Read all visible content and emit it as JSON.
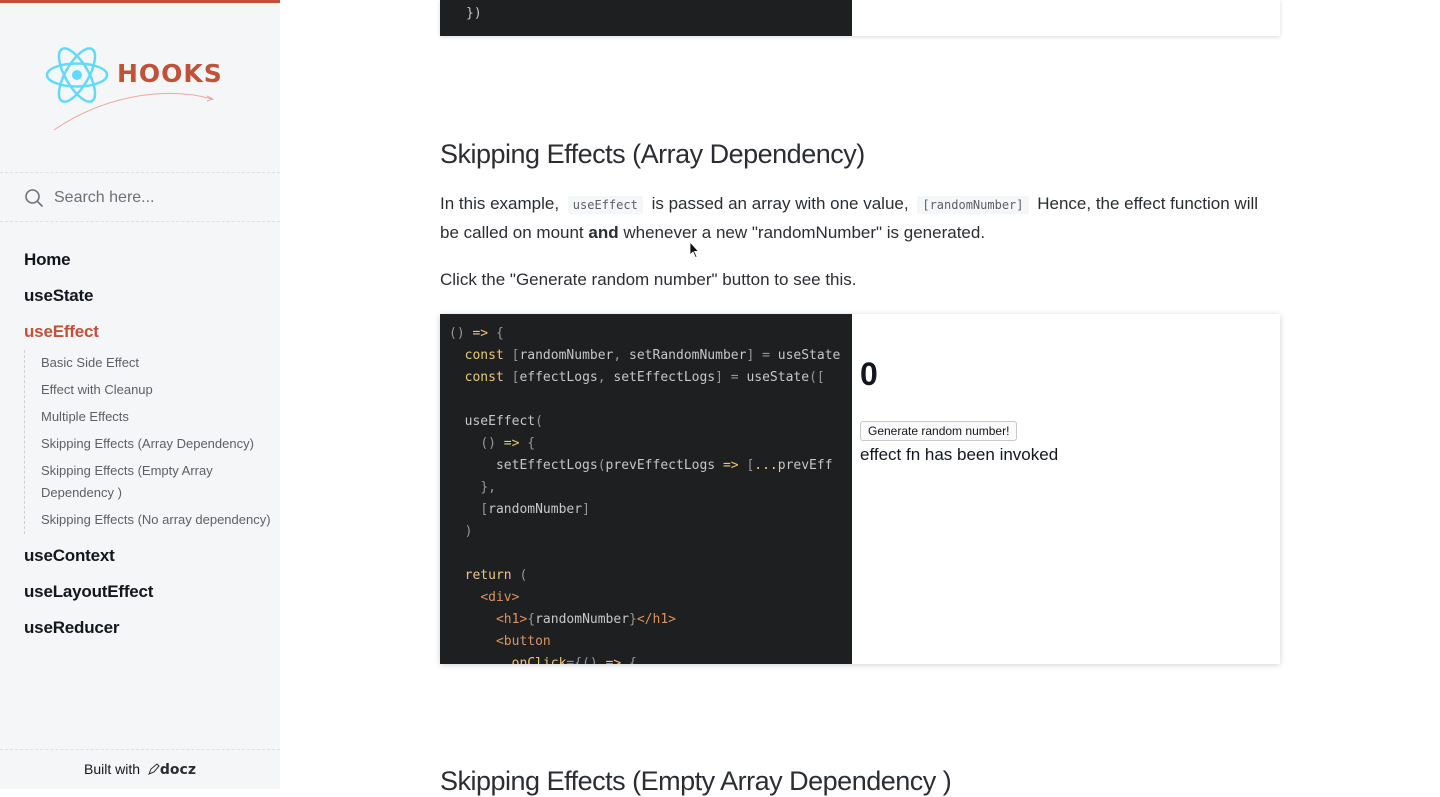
{
  "sidebar": {
    "logo_text": "HOOKS",
    "search_placeholder": "Search here...",
    "nav": {
      "home": "Home",
      "usestate": "useState",
      "useeffect": "useEffect",
      "sub_items": [
        "Basic Side Effect",
        "Effect with Cleanup",
        "Multiple Effects",
        "Skipping Effects (Array Dependency)",
        "Skipping Effects (Empty Array Dependency )",
        "Skipping Effects (No array dependency)"
      ],
      "usecontext": "useContext",
      "uselayouteffect": "useLayoutEffect",
      "usereducer": "useReducer"
    },
    "footer": {
      "built_with": "Built with",
      "brand": "docz"
    }
  },
  "main": {
    "top_code_line": "})",
    "section_title": "Skipping Effects (Array Dependency)",
    "paragraph1": {
      "part1": "In this example,",
      "code1": "useEffect",
      "part2": "is passed an array with one value,",
      "code2": "[randomNumber]",
      "part3": "Hence, the effect function will be called on mount",
      "bold": "and",
      "part4": "whenever a new \"randomNumber\" is generated."
    },
    "paragraph2": "Click the \"Generate random number\" button to see this.",
    "playground": {
      "random_number": "0",
      "button_label": "Generate random number!",
      "log_text": "effect fn has been invoked"
    },
    "next_section_title": "Skipping Effects (Empty Array Dependency )"
  },
  "colors": {
    "accent": "#c2513a",
    "react_blue": "#61dafb",
    "code_bg": "#1d1f21"
  },
  "icons": [
    "react-atom-logo-icon",
    "search-icon",
    "docz-logo-icon",
    "mouse-cursor-icon"
  ]
}
